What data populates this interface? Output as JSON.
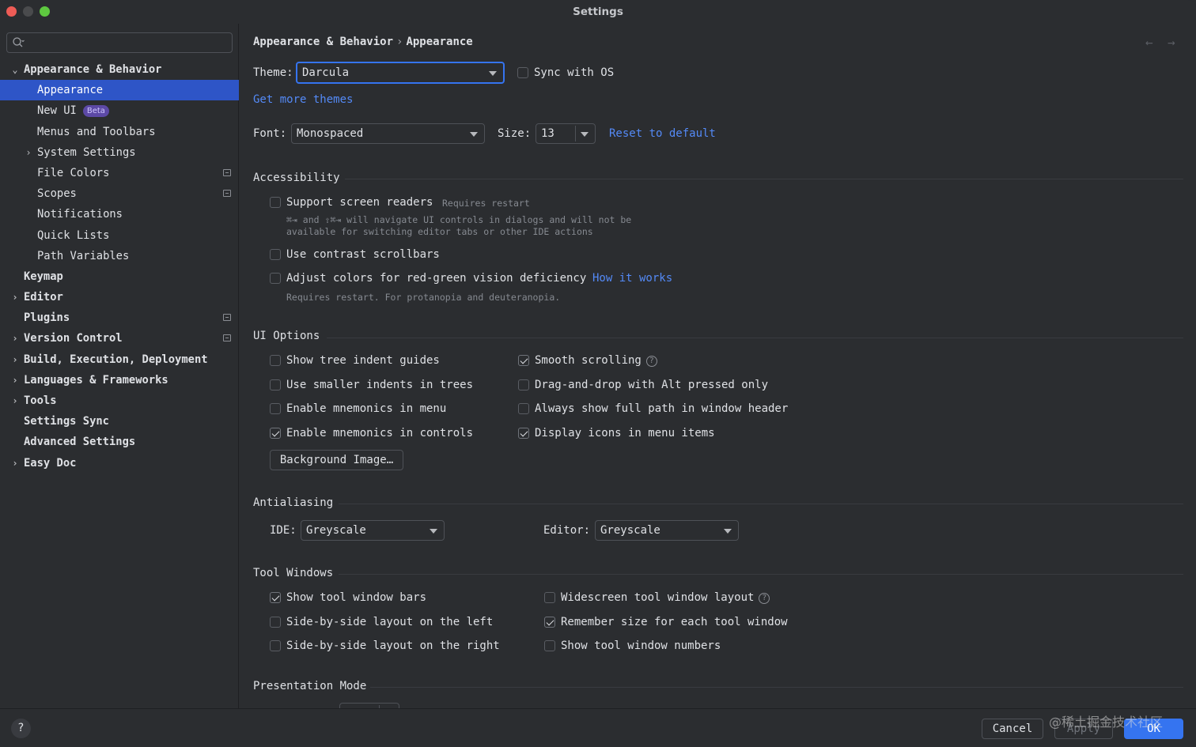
{
  "window": {
    "title": "Settings"
  },
  "sidebar": {
    "search_placeholder": "",
    "items": [
      {
        "label": "Appearance & Behavior",
        "expanded": true
      },
      {
        "label": "Appearance",
        "selected": true
      },
      {
        "label": "New UI",
        "badge": "Beta"
      },
      {
        "label": "Menus and Toolbars"
      },
      {
        "label": "System Settings"
      },
      {
        "label": "File Colors"
      },
      {
        "label": "Scopes"
      },
      {
        "label": "Notifications"
      },
      {
        "label": "Quick Lists"
      },
      {
        "label": "Path Variables"
      },
      {
        "label": "Keymap"
      },
      {
        "label": "Editor"
      },
      {
        "label": "Plugins"
      },
      {
        "label": "Version Control"
      },
      {
        "label": "Build, Execution, Deployment"
      },
      {
        "label": "Languages & Frameworks"
      },
      {
        "label": "Tools"
      },
      {
        "label": "Settings Sync"
      },
      {
        "label": "Advanced Settings"
      },
      {
        "label": "Easy Doc"
      }
    ]
  },
  "breadcrumb": {
    "parent": "Appearance & Behavior",
    "separator": "›",
    "current": "Appearance"
  },
  "nav": {
    "back_icon": "arrow-left-icon",
    "forward_icon": "arrow-right-icon"
  },
  "theme": {
    "label": "Theme:",
    "value": "Darcula",
    "sync_label": "Sync with OS",
    "sync_checked": false,
    "get_more": "Get more themes"
  },
  "font": {
    "label": "Font:",
    "value": "Monospaced",
    "size_label": "Size:",
    "size_value": "13",
    "reset": "Reset to default"
  },
  "accessibility": {
    "title": "Accessibility",
    "screen_readers": "Support screen readers",
    "requires_restart": "Requires restart",
    "screen_readers_note1": "⌘⇥ and ⇧⌘⇥ will navigate UI controls in dialogs and will not be",
    "screen_readers_note2": "available for switching editor tabs or other IDE actions",
    "contrast_scrollbars": "Use contrast scrollbars",
    "color_deficiency": "Adjust colors for red-green vision deficiency",
    "how_it_works": "How it works",
    "color_deficiency_note": "Requires restart. For protanopia and deuteranopia."
  },
  "ui_options": {
    "title": "UI Options",
    "left": [
      {
        "label": "Show tree indent guides",
        "checked": false
      },
      {
        "label": "Use smaller indents in trees",
        "checked": false
      },
      {
        "label": "Enable mnemonics in menu",
        "checked": false
      },
      {
        "label": "Enable mnemonics in controls",
        "checked": true
      }
    ],
    "right": [
      {
        "label": "Smooth scrolling",
        "checked": true
      },
      {
        "label": "Drag-and-drop with Alt pressed only",
        "checked": false
      },
      {
        "label": "Always show full path in window header",
        "checked": false
      },
      {
        "label": "Display icons in menu items",
        "checked": true
      }
    ],
    "background_image": "Background Image…"
  },
  "antialiasing": {
    "title": "Antialiasing",
    "ide_label": "IDE:",
    "ide_value": "Greyscale",
    "editor_label": "Editor:",
    "editor_value": "Greyscale"
  },
  "tool_windows": {
    "title": "Tool Windows",
    "left": [
      {
        "label": "Show tool window bars",
        "checked": true
      },
      {
        "label": "Side-by-side layout on the left",
        "checked": false
      },
      {
        "label": "Side-by-side layout on the right",
        "checked": false
      }
    ],
    "right": [
      {
        "label": "Widescreen tool window layout",
        "checked": false
      },
      {
        "label": "Remember size for each tool window",
        "checked": true
      },
      {
        "label": "Show tool window numbers",
        "checked": false
      }
    ]
  },
  "presentation": {
    "title": "Presentation Mode"
  },
  "footer": {
    "help": "?",
    "cancel": "Cancel",
    "apply": "Apply",
    "ok": "OK",
    "watermark": "@稀土掘金技术社区"
  },
  "colors": {
    "accent": "#3574f0",
    "selection": "#2e55c7",
    "link": "#548af7",
    "background": "#2b2d30"
  }
}
